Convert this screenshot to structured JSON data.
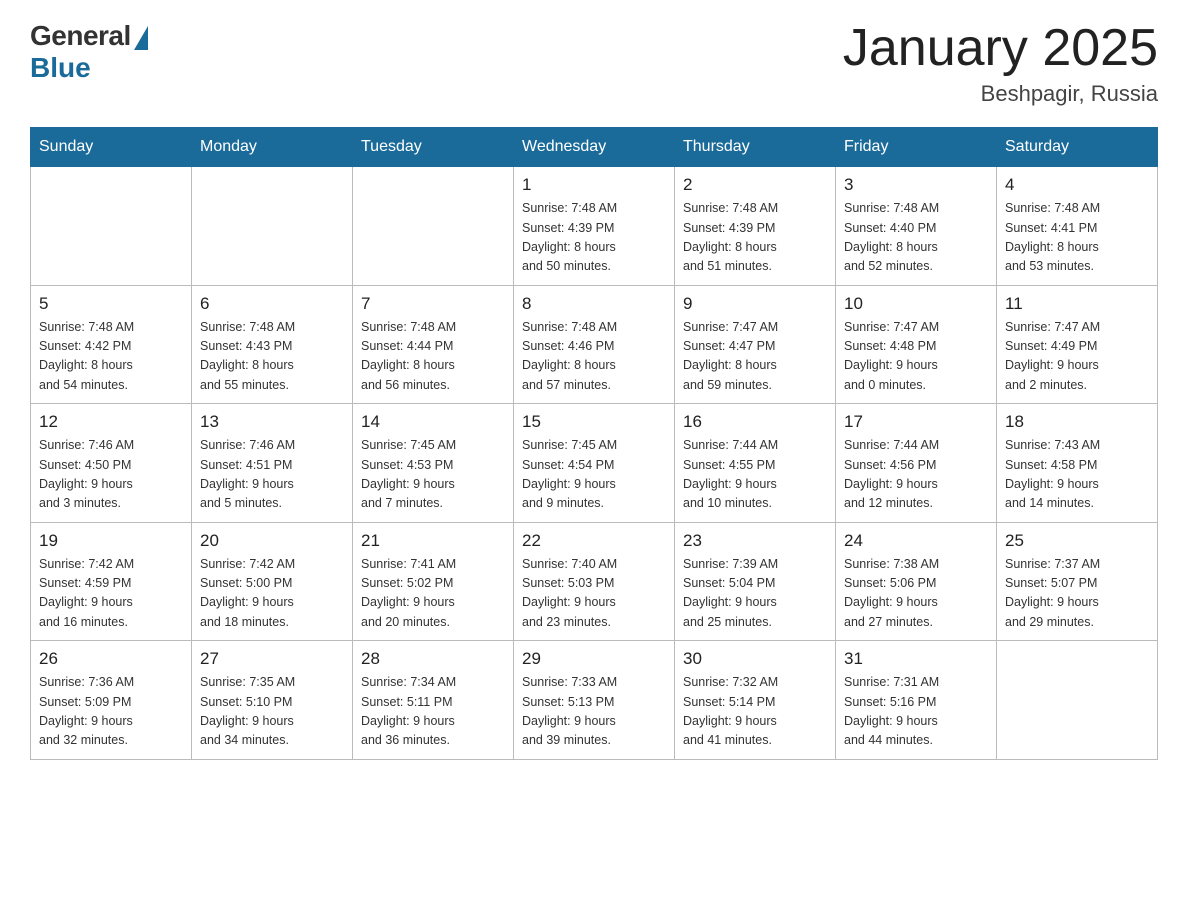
{
  "header": {
    "logo_general": "General",
    "logo_blue": "Blue",
    "month_title": "January 2025",
    "location": "Beshpagir, Russia"
  },
  "days_of_week": [
    "Sunday",
    "Monday",
    "Tuesday",
    "Wednesday",
    "Thursday",
    "Friday",
    "Saturday"
  ],
  "weeks": [
    [
      {
        "day": "",
        "info": ""
      },
      {
        "day": "",
        "info": ""
      },
      {
        "day": "",
        "info": ""
      },
      {
        "day": "1",
        "info": "Sunrise: 7:48 AM\nSunset: 4:39 PM\nDaylight: 8 hours\nand 50 minutes."
      },
      {
        "day": "2",
        "info": "Sunrise: 7:48 AM\nSunset: 4:39 PM\nDaylight: 8 hours\nand 51 minutes."
      },
      {
        "day": "3",
        "info": "Sunrise: 7:48 AM\nSunset: 4:40 PM\nDaylight: 8 hours\nand 52 minutes."
      },
      {
        "day": "4",
        "info": "Sunrise: 7:48 AM\nSunset: 4:41 PM\nDaylight: 8 hours\nand 53 minutes."
      }
    ],
    [
      {
        "day": "5",
        "info": "Sunrise: 7:48 AM\nSunset: 4:42 PM\nDaylight: 8 hours\nand 54 minutes."
      },
      {
        "day": "6",
        "info": "Sunrise: 7:48 AM\nSunset: 4:43 PM\nDaylight: 8 hours\nand 55 minutes."
      },
      {
        "day": "7",
        "info": "Sunrise: 7:48 AM\nSunset: 4:44 PM\nDaylight: 8 hours\nand 56 minutes."
      },
      {
        "day": "8",
        "info": "Sunrise: 7:48 AM\nSunset: 4:46 PM\nDaylight: 8 hours\nand 57 minutes."
      },
      {
        "day": "9",
        "info": "Sunrise: 7:47 AM\nSunset: 4:47 PM\nDaylight: 8 hours\nand 59 minutes."
      },
      {
        "day": "10",
        "info": "Sunrise: 7:47 AM\nSunset: 4:48 PM\nDaylight: 9 hours\nand 0 minutes."
      },
      {
        "day": "11",
        "info": "Sunrise: 7:47 AM\nSunset: 4:49 PM\nDaylight: 9 hours\nand 2 minutes."
      }
    ],
    [
      {
        "day": "12",
        "info": "Sunrise: 7:46 AM\nSunset: 4:50 PM\nDaylight: 9 hours\nand 3 minutes."
      },
      {
        "day": "13",
        "info": "Sunrise: 7:46 AM\nSunset: 4:51 PM\nDaylight: 9 hours\nand 5 minutes."
      },
      {
        "day": "14",
        "info": "Sunrise: 7:45 AM\nSunset: 4:53 PM\nDaylight: 9 hours\nand 7 minutes."
      },
      {
        "day": "15",
        "info": "Sunrise: 7:45 AM\nSunset: 4:54 PM\nDaylight: 9 hours\nand 9 minutes."
      },
      {
        "day": "16",
        "info": "Sunrise: 7:44 AM\nSunset: 4:55 PM\nDaylight: 9 hours\nand 10 minutes."
      },
      {
        "day": "17",
        "info": "Sunrise: 7:44 AM\nSunset: 4:56 PM\nDaylight: 9 hours\nand 12 minutes."
      },
      {
        "day": "18",
        "info": "Sunrise: 7:43 AM\nSunset: 4:58 PM\nDaylight: 9 hours\nand 14 minutes."
      }
    ],
    [
      {
        "day": "19",
        "info": "Sunrise: 7:42 AM\nSunset: 4:59 PM\nDaylight: 9 hours\nand 16 minutes."
      },
      {
        "day": "20",
        "info": "Sunrise: 7:42 AM\nSunset: 5:00 PM\nDaylight: 9 hours\nand 18 minutes."
      },
      {
        "day": "21",
        "info": "Sunrise: 7:41 AM\nSunset: 5:02 PM\nDaylight: 9 hours\nand 20 minutes."
      },
      {
        "day": "22",
        "info": "Sunrise: 7:40 AM\nSunset: 5:03 PM\nDaylight: 9 hours\nand 23 minutes."
      },
      {
        "day": "23",
        "info": "Sunrise: 7:39 AM\nSunset: 5:04 PM\nDaylight: 9 hours\nand 25 minutes."
      },
      {
        "day": "24",
        "info": "Sunrise: 7:38 AM\nSunset: 5:06 PM\nDaylight: 9 hours\nand 27 minutes."
      },
      {
        "day": "25",
        "info": "Sunrise: 7:37 AM\nSunset: 5:07 PM\nDaylight: 9 hours\nand 29 minutes."
      }
    ],
    [
      {
        "day": "26",
        "info": "Sunrise: 7:36 AM\nSunset: 5:09 PM\nDaylight: 9 hours\nand 32 minutes."
      },
      {
        "day": "27",
        "info": "Sunrise: 7:35 AM\nSunset: 5:10 PM\nDaylight: 9 hours\nand 34 minutes."
      },
      {
        "day": "28",
        "info": "Sunrise: 7:34 AM\nSunset: 5:11 PM\nDaylight: 9 hours\nand 36 minutes."
      },
      {
        "day": "29",
        "info": "Sunrise: 7:33 AM\nSunset: 5:13 PM\nDaylight: 9 hours\nand 39 minutes."
      },
      {
        "day": "30",
        "info": "Sunrise: 7:32 AM\nSunset: 5:14 PM\nDaylight: 9 hours\nand 41 minutes."
      },
      {
        "day": "31",
        "info": "Sunrise: 7:31 AM\nSunset: 5:16 PM\nDaylight: 9 hours\nand 44 minutes."
      },
      {
        "day": "",
        "info": ""
      }
    ]
  ]
}
